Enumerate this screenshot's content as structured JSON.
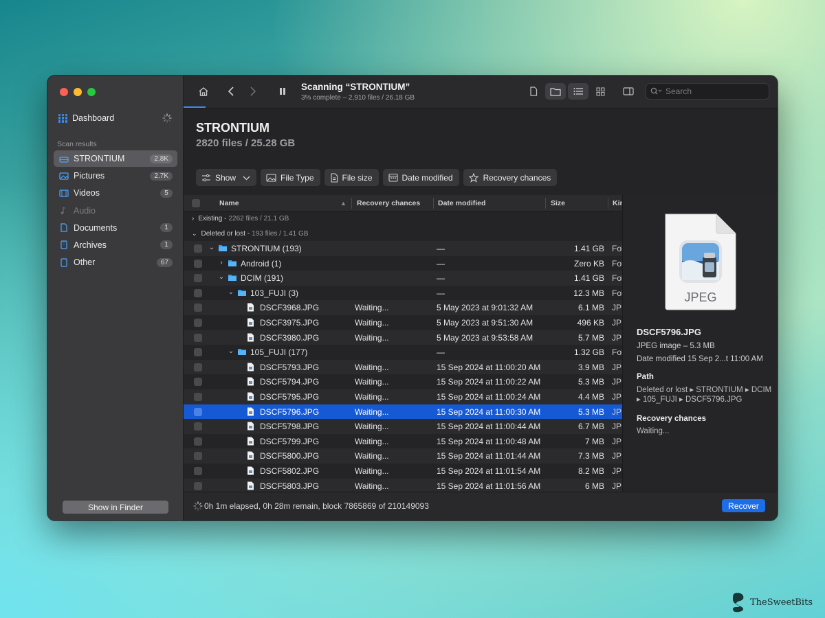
{
  "sidebar": {
    "dashboard": "Dashboard",
    "section_label": "Scan results",
    "items": [
      {
        "label": "STRONTIUM",
        "count": "2.8K",
        "icon": "drive-icon"
      },
      {
        "label": "Pictures",
        "count": "2.7K",
        "icon": "picture-icon"
      },
      {
        "label": "Videos",
        "count": "5",
        "icon": "film-icon"
      },
      {
        "label": "Audio",
        "count": "",
        "icon": "music-note-icon"
      },
      {
        "label": "Documents",
        "count": "1",
        "icon": "document-icon"
      },
      {
        "label": "Archives",
        "count": "1",
        "icon": "archive-icon"
      },
      {
        "label": "Other",
        "count": "67",
        "icon": "other-file-icon"
      }
    ],
    "show_in_finder": "Show in Finder"
  },
  "toolbar": {
    "title": "Scanning “STRONTIUM”",
    "subtitle": "3% complete – 2,910 files / 26.18 GB",
    "search_placeholder": "Search"
  },
  "volume": {
    "title": "STRONTIUM",
    "subtitle": "2820 files / 25.28 GB"
  },
  "filters": [
    "Show",
    "File Type",
    "File size",
    "Date modified",
    "Recovery chances"
  ],
  "table": {
    "columns": [
      "Name",
      "Recovery chances",
      "Date modified",
      "Size",
      "Kind"
    ],
    "groups": {
      "existing": {
        "label": "Existing -",
        "count": "2262 files / 21.1 GB"
      },
      "deleted": {
        "label": "Deleted or lost -",
        "count": "193 files / 1.41 GB"
      }
    },
    "rows": [
      {
        "name": "STRONTIUM (193)",
        "type": "folder",
        "level": 0,
        "disc": "open",
        "rc": "",
        "dm": "—",
        "size": "1.41 GB",
        "kind": "Folder"
      },
      {
        "name": "Android (1)",
        "type": "folder",
        "level": 1,
        "disc": "closed",
        "rc": "",
        "dm": "—",
        "size": "Zero KB",
        "kind": "Folder"
      },
      {
        "name": "DCIM (191)",
        "type": "folder",
        "level": 1,
        "disc": "open",
        "rc": "",
        "dm": "—",
        "size": "1.41 GB",
        "kind": "Folder"
      },
      {
        "name": "103_FUJI (3)",
        "type": "folder",
        "level": 2,
        "disc": "open",
        "rc": "",
        "dm": "—",
        "size": "12.3 MB",
        "kind": "Folder"
      },
      {
        "name": "DSCF3968.JPG",
        "type": "file",
        "level": 3,
        "disc": "",
        "rc": "Waiting...",
        "dm": "5 May 2023 at 9:01:32 AM",
        "size": "6.1 MB",
        "kind": "JPEG"
      },
      {
        "name": "DSCF3975.JPG",
        "type": "file",
        "level": 3,
        "disc": "",
        "rc": "Waiting...",
        "dm": "5 May 2023 at 9:51:30 AM",
        "size": "496 KB",
        "kind": "JPEG"
      },
      {
        "name": "DSCF3980.JPG",
        "type": "file",
        "level": 3,
        "disc": "",
        "rc": "Waiting...",
        "dm": "5 May 2023 at 9:53:58 AM",
        "size": "5.7 MB",
        "kind": "JPEG"
      },
      {
        "name": "105_FUJI (177)",
        "type": "folder",
        "level": 2,
        "disc": "open",
        "rc": "",
        "dm": "—",
        "size": "1.32 GB",
        "kind": "Folder"
      },
      {
        "name": "DSCF5793.JPG",
        "type": "file",
        "level": 3,
        "disc": "",
        "rc": "Waiting...",
        "dm": "15 Sep 2024 at 11:00:20 AM",
        "size": "3.9 MB",
        "kind": "JPEG"
      },
      {
        "name": "DSCF5794.JPG",
        "type": "file",
        "level": 3,
        "disc": "",
        "rc": "Waiting...",
        "dm": "15 Sep 2024 at 11:00:22 AM",
        "size": "5.3 MB",
        "kind": "JPEG"
      },
      {
        "name": "DSCF5795.JPG",
        "type": "file",
        "level": 3,
        "disc": "",
        "rc": "Waiting...",
        "dm": "15 Sep 2024 at 11:00:24 AM",
        "size": "4.4 MB",
        "kind": "JPEG"
      },
      {
        "name": "DSCF5796.JPG",
        "type": "file",
        "level": 3,
        "disc": "",
        "rc": "Waiting...",
        "dm": "15 Sep 2024 at 11:00:30 AM",
        "size": "5.3 MB",
        "kind": "JPEG",
        "selected": true
      },
      {
        "name": "DSCF5798.JPG",
        "type": "file",
        "level": 3,
        "disc": "",
        "rc": "Waiting...",
        "dm": "15 Sep 2024 at 11:00:44 AM",
        "size": "6.7 MB",
        "kind": "JPEG"
      },
      {
        "name": "DSCF5799.JPG",
        "type": "file",
        "level": 3,
        "disc": "",
        "rc": "Waiting...",
        "dm": "15 Sep 2024 at 11:00:48 AM",
        "size": "7 MB",
        "kind": "JPEG"
      },
      {
        "name": "DSCF5800.JPG",
        "type": "file",
        "level": 3,
        "disc": "",
        "rc": "Waiting...",
        "dm": "15 Sep 2024 at 11:01:44 AM",
        "size": "7.3 MB",
        "kind": "JPEG"
      },
      {
        "name": "DSCF5802.JPG",
        "type": "file",
        "level": 3,
        "disc": "",
        "rc": "Waiting...",
        "dm": "15 Sep 2024 at 11:01:54 AM",
        "size": "8.2 MB",
        "kind": "JPEG"
      },
      {
        "name": "DSCF5803.JPG",
        "type": "file",
        "level": 3,
        "disc": "",
        "rc": "Waiting...",
        "dm": "15 Sep 2024 at 11:01:56 AM",
        "size": "6 MB",
        "kind": "JPEG"
      }
    ]
  },
  "preview": {
    "icon_label": "JPEG",
    "file_name": "DSCF5796.JPG",
    "kind_line": "JPEG image – 5.3 MB",
    "date_line": "Date modified  15 Sep 2...t 11:00 AM",
    "path_heading": "Path",
    "path_value": "Deleted or lost ▸ STRONTIUM ▸ DCIM ▸ 105_FUJI ▸ DSCF5796.JPG",
    "recovery_heading": "Recovery chances",
    "recovery_value": "Waiting..."
  },
  "status": {
    "text": "0h 1m elapsed, 0h 28m remain, block 7865869 of 210149093",
    "recover": "Recover"
  },
  "watermark": "TheSweetBits",
  "colors": {
    "accent": "#1d6ee6",
    "selection": "#1559d4",
    "folder": "#2f9df2"
  }
}
